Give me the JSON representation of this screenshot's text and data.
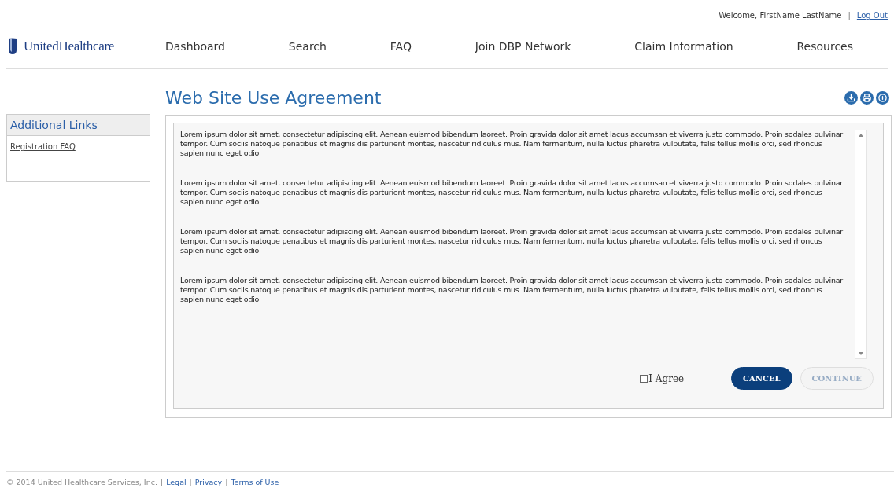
{
  "header": {
    "welcome": "Welcome, FirstName LastName",
    "separator": "|",
    "logout": "Log Out"
  },
  "logo": {
    "name": "UnitedHealthcare"
  },
  "nav": [
    {
      "label": "Dashboard"
    },
    {
      "label": "Search"
    },
    {
      "label": "FAQ"
    },
    {
      "label": "Join DBP Network"
    },
    {
      "label": "Claim Information"
    },
    {
      "label": "Resources"
    }
  ],
  "page": {
    "title": "Web Site Use Agreement",
    "tools": [
      {
        "kind": "download"
      },
      {
        "kind": "print"
      },
      {
        "kind": "info"
      }
    ]
  },
  "sidebar": {
    "title": "Additional Links",
    "links": [
      "Registration FAQ"
    ]
  },
  "agreement": {
    "paragraphs": [
      "Lorem ipsum dolor sit amet, consectetur adipiscing elit. Aenean euismod bibendum laoreet. Proin gravida dolor sit amet lacus accumsan et viverra justo commodo. Proin sodales pulvinar tempor. Cum sociis natoque penatibus et magnis dis parturient montes, nascetur ridiculus mus. Nam fermentum, nulla luctus pharetra vulputate, felis tellus mollis orci, sed rhoncus sapien nunc eget odio.",
      "Lorem ipsum dolor sit amet, consectetur adipiscing elit. Aenean euismod bibendum laoreet. Proin gravida dolor sit amet lacus accumsan et viverra justo commodo. Proin sodales pulvinar tempor. Cum sociis natoque penatibus et magnis dis parturient montes, nascetur ridiculus mus. Nam fermentum, nulla luctus pharetra vulputate, felis tellus mollis orci, sed rhoncus sapien nunc eget odio.",
      "Lorem ipsum dolor sit amet, consectetur adipiscing elit. Aenean euismod bibendum laoreet. Proin gravida dolor sit amet lacus accumsan et viverra justo commodo. Proin sodales pulvinar tempor. Cum sociis natoque penatibus et magnis dis parturient montes, nascetur ridiculus mus. Nam fermentum, nulla luctus pharetra vulputate, felis tellus mollis orci, sed rhoncus sapien nunc eget odio.",
      "Lorem ipsum dolor sit amet, consectetur adipiscing elit. Aenean euismod bibendum laoreet. Proin gravida dolor sit amet lacus accumsan et viverra justo commodo. Proin sodales pulvinar tempor. Cum sociis natoque penatibus et magnis dis parturient montes, nascetur ridiculus mus. Nam fermentum, nulla luctus pharetra vulputate, felis tellus mollis orci, sed rhoncus sapien nunc eget odio."
    ],
    "agree": {
      "label": "I Agree",
      "checked": false
    },
    "buttons": [
      {
        "label": "CANCEL",
        "kind": "primary",
        "disabled": false
      },
      {
        "label": "CONTINUE",
        "kind": "secondary",
        "disabled": true
      }
    ]
  },
  "footer": [
    {
      "kind": "text",
      "text": "© 2014 United Healthcare Services, Inc."
    },
    {
      "kind": "separator",
      "text": "|"
    },
    {
      "kind": "link",
      "text": "Legal"
    },
    {
      "kind": "separator",
      "text": "|"
    },
    {
      "kind": "link",
      "text": "Privacy"
    },
    {
      "kind": "separator",
      "text": "|"
    },
    {
      "kind": "link",
      "text": "Terms of Use"
    }
  ]
}
